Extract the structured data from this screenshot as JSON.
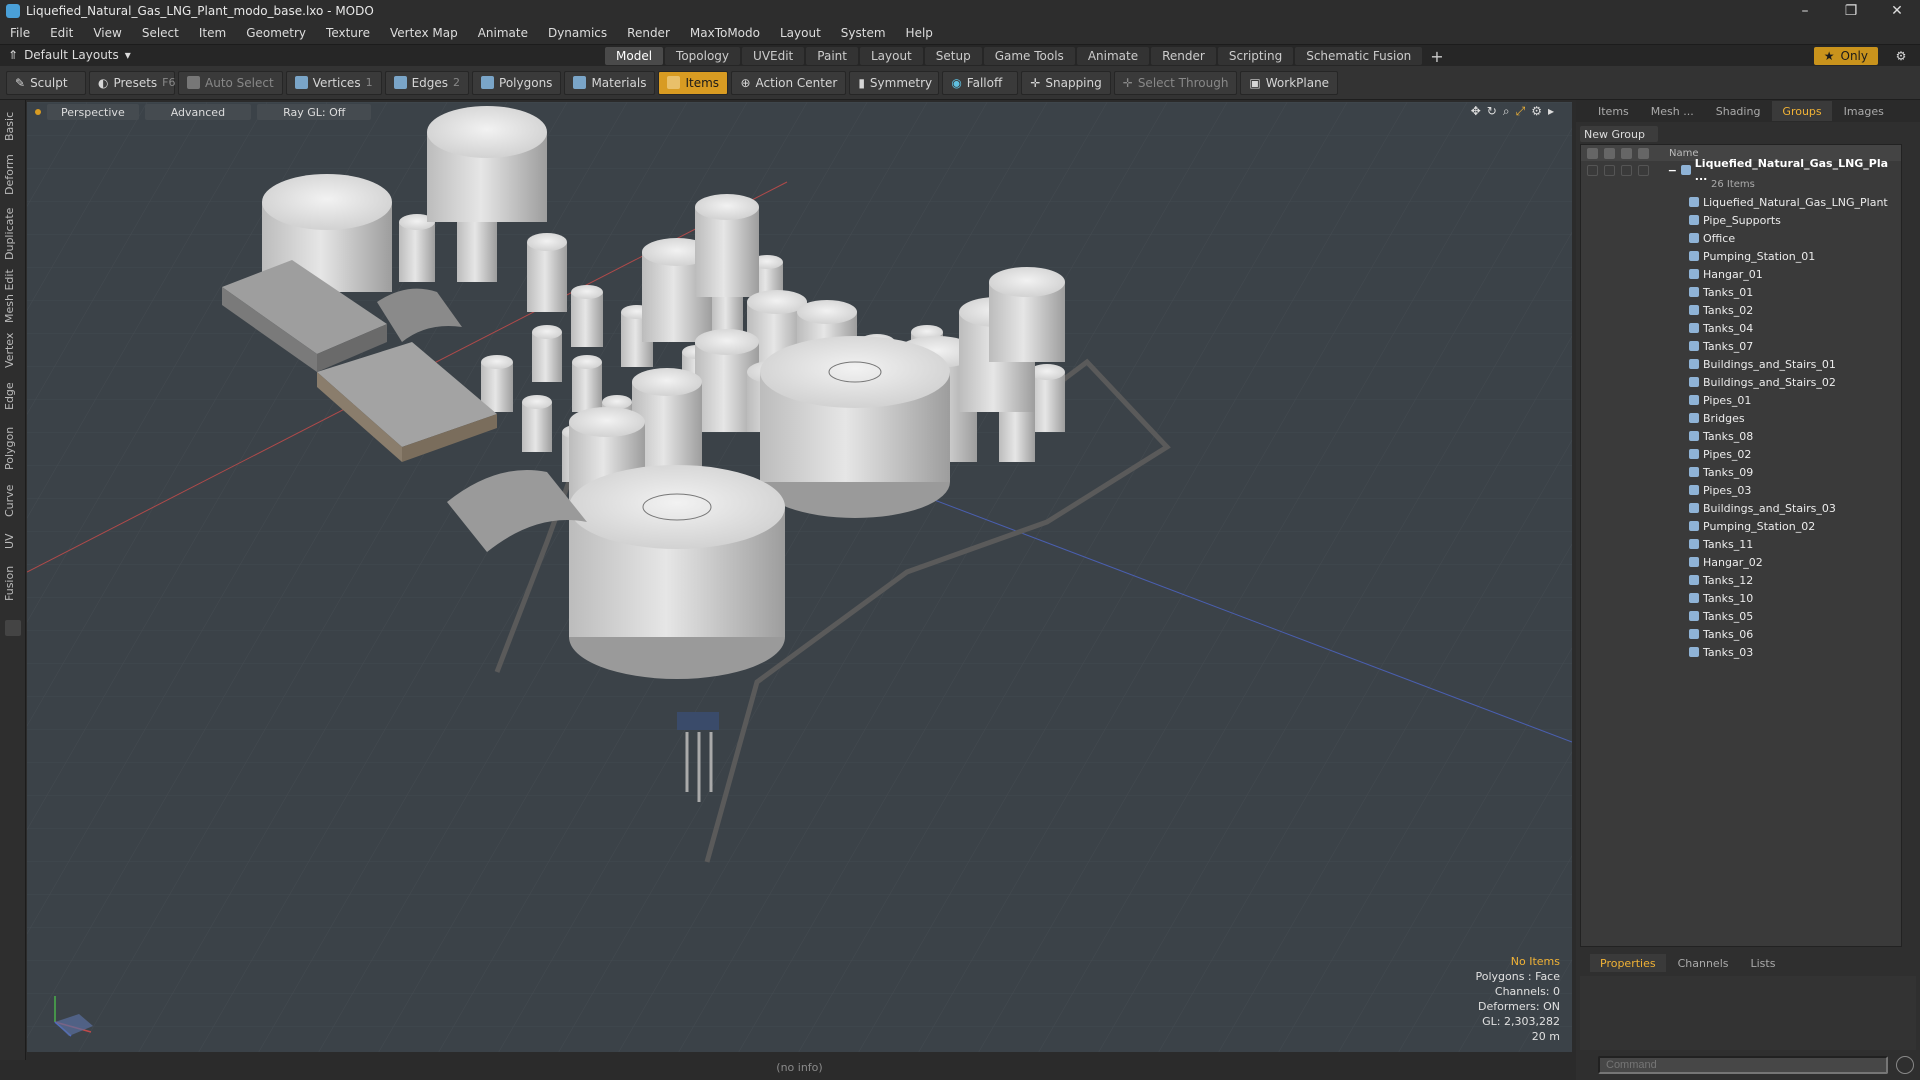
{
  "window": {
    "title": "Liquefied_Natural_Gas_LNG_Plant_modo_base.lxo - MODO",
    "minimize": "–",
    "maximize": "❐",
    "close": "✕"
  },
  "menu": [
    "File",
    "Edit",
    "View",
    "Select",
    "Item",
    "Geometry",
    "Texture",
    "Vertex Map",
    "Animate",
    "Dynamics",
    "Render",
    "MaxToModo",
    "Layout",
    "System",
    "Help"
  ],
  "layouts": {
    "selector_label": "Default Layouts",
    "tabs": [
      "Model",
      "Topology",
      "UVEdit",
      "Paint",
      "Layout",
      "Setup",
      "Game Tools",
      "Animate",
      "Render",
      "Scripting",
      "Schematic Fusion"
    ],
    "active_tab": "Model",
    "plus": "+",
    "only_label": "Only"
  },
  "toolbar": {
    "sculpt": "Sculpt",
    "presets": "Presets",
    "presets_key": "F6",
    "auto_select": "Auto Select",
    "vertices": "Vertices",
    "vertices_key": "1",
    "edges": "Edges",
    "edges_key": "2",
    "polygons": "Polygons",
    "materials": "Materials",
    "items": "Items",
    "action_center": "Action Center",
    "symmetry": "Symmetry",
    "falloff": "Falloff",
    "snapping": "Snapping",
    "select_through": "Select Through",
    "workplane": "WorkPlane"
  },
  "left_tabs": [
    "Basic",
    "Deform",
    "Duplicate",
    "Mesh Edit",
    "Vertex",
    "Edge",
    "Polygon",
    "Curve",
    "UV",
    "Fusion"
  ],
  "viewport": {
    "view_mode": "Perspective",
    "shading": "Advanced",
    "raygl": "Ray GL: Off",
    "info": {
      "selection": "No Items",
      "polygons": "Polygons : Face",
      "channels": "Channels: 0",
      "deformers": "Deformers: ON",
      "gl": "GL: 2,303,282",
      "scale": "20 m"
    }
  },
  "status": "(no info)",
  "panel": {
    "tabs": [
      "Items",
      "Mesh ...",
      "Shading",
      "Groups",
      "Images"
    ],
    "active_tab": "Groups",
    "new_group": "New Group",
    "column_name": "Name",
    "root": "Liquefied_Natural_Gas_LNG_Pla ...",
    "root_count": "26 Items",
    "items": [
      "Liquefied_Natural_Gas_LNG_Plant",
      "Pipe_Supports",
      "Office",
      "Pumping_Station_01",
      "Hangar_01",
      "Tanks_01",
      "Tanks_02",
      "Tanks_04",
      "Tanks_07",
      "Buildings_and_Stairs_01",
      "Buildings_and_Stairs_02",
      "Pipes_01",
      "Bridges",
      "Tanks_08",
      "Pipes_02",
      "Tanks_09",
      "Pipes_03",
      "Buildings_and_Stairs_03",
      "Pumping_Station_02",
      "Tanks_11",
      "Hangar_02",
      "Tanks_12",
      "Tanks_10",
      "Tanks_05",
      "Tanks_06",
      "Tanks_03"
    ],
    "bottom_tabs": [
      "Properties",
      "Channels",
      "Lists"
    ],
    "bottom_active": "Properties",
    "command_placeholder": "Command"
  }
}
